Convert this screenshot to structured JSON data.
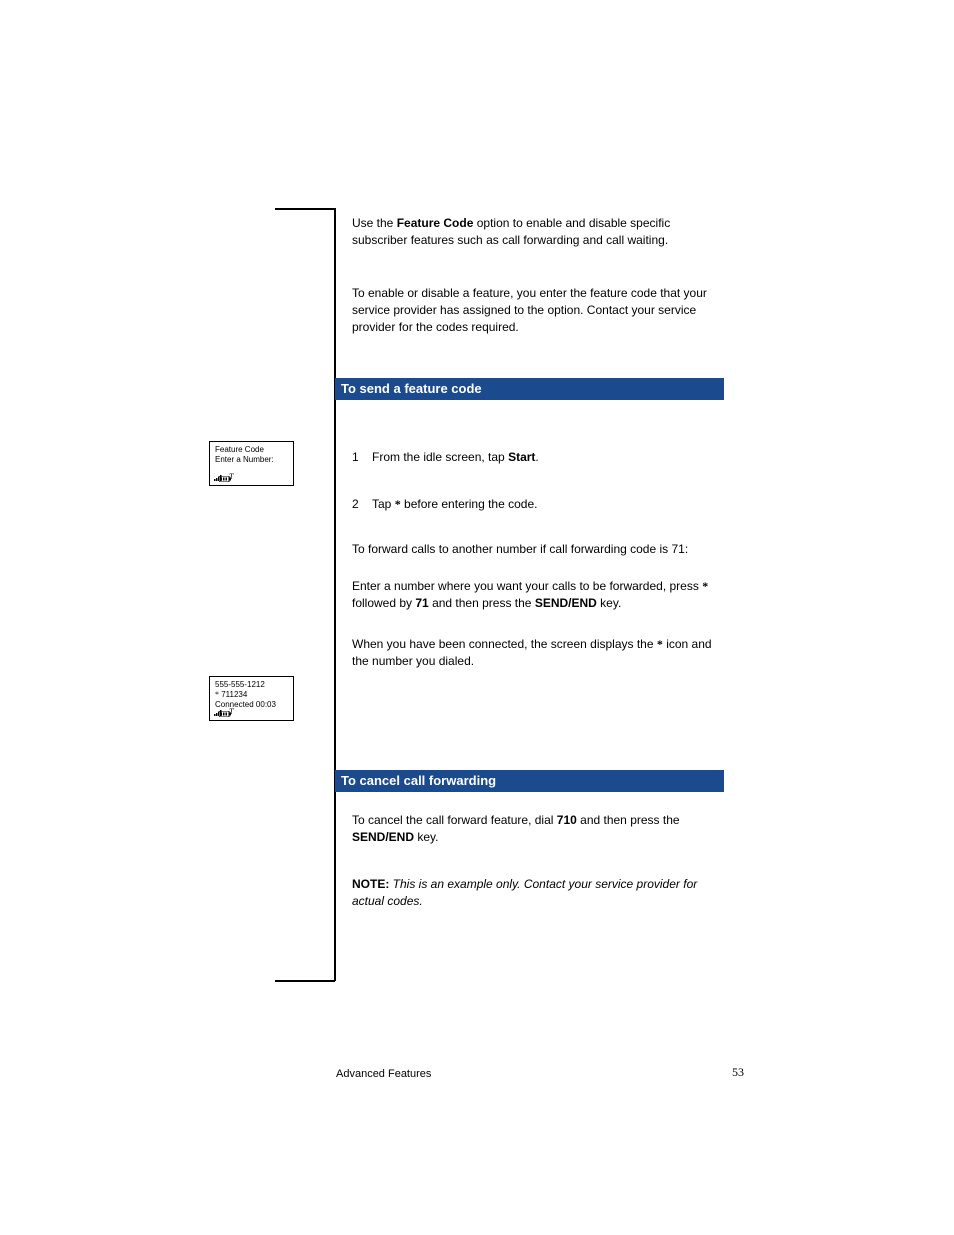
{
  "intro": {
    "p1": "Use the Feature Code option to enable and disable specific subscriber features such as call forwarding and call waiting.",
    "p2": "To enable or disable a feature, you enter the feature code that your service provider has assigned to the option. Contact your service provider for the codes required.",
    "p1_words": {
      "a": "Use the ",
      "b": "Feature Code ",
      "c": "option to enable and disable specific subscriber features such as call forwarding and call waiting."
    }
  },
  "section1": {
    "title": "To send a feature code",
    "steps": [
      {
        "n": "1",
        "t": "From the idle screen, tap ",
        "b": "Start",
        "t2": "."
      },
      {
        "n": "2",
        "t": "Tap ",
        "b": " ",
        "t2": " before entering the code."
      }
    ],
    "para_a": "To forward calls to another number if call forwarding code is 71:",
    "para_b_a": "Enter a number where you want your calls to be forwarded, press ",
    "para_b_b": " followed by ",
    "para_b_c": "71",
    "para_b_d": " and then press the ",
    "para_b_e": "SEND/END",
    "para_b_f": " key.",
    "para_c_a": "When you have been connected, the screen displays the ",
    "para_c_b": " icon and the number you dialed."
  },
  "section2": {
    "title": "To cancel call forwarding",
    "p1_a": "To cancel the call forward feature, dial ",
    "p1_b": "710",
    "p1_c": " and then press the ",
    "p1_d": "SEND/END",
    "p1_e": " key.",
    "note_label": "NOTE: ",
    "note_text": "This is an example only. Contact your service provider for actual codes."
  },
  "screen1": {
    "line1": "Feature Code",
    "line2": "Enter a Number:"
  },
  "screen2": {
    "line1": "555-555-1212",
    "line2": "    711234",
    "line3": "Connected 00:03"
  },
  "footer": "Advanced Features",
  "pagenum": "53"
}
